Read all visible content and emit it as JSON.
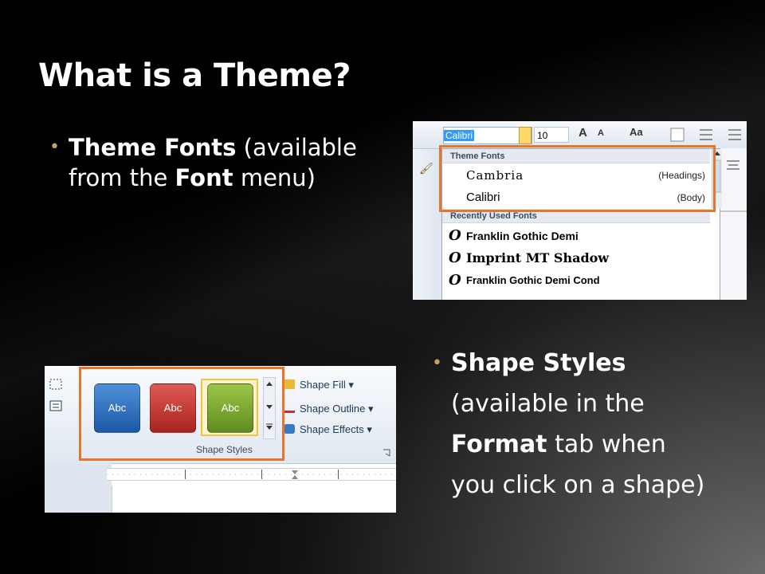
{
  "slide": {
    "title": "What is a Theme?",
    "bullet1": {
      "bold1": "Theme Fonts",
      "text1": " (available from the ",
      "bold2": "Font",
      "text2": " menu)"
    },
    "bullet2": {
      "bold1": "Shape Styles",
      "text1": " (available in the ",
      "bold2": "Format",
      "text2": " tab when you click on a shape)"
    },
    "bullet_color": "#c8a063",
    "highlight_color": "#e8752a"
  },
  "font_menu": {
    "font_name": "Calibri",
    "font_size": "10",
    "grow_label": "A",
    "shrink_label": "A",
    "case_label": "Aa",
    "theme_header": "Theme Fonts",
    "theme_fonts": [
      {
        "name": "Cambria",
        "tag": "(Headings)"
      },
      {
        "name": "Calibri",
        "tag": "(Body)"
      }
    ],
    "recent_header": "Recently Used Fonts",
    "recent_fonts": [
      "Franklin Gothic Demi",
      "Imprint MT Shadow",
      "Franklin Gothic Demi Cond"
    ]
  },
  "shape_styles": {
    "swatches": [
      {
        "label": "Abc",
        "color": "#2e6db6"
      },
      {
        "label": "Abc",
        "color": "#c0312f"
      },
      {
        "label": "Abc",
        "color": "#79a72c"
      }
    ],
    "group_caption": "Shape Styles",
    "commands": [
      "Shape Fill",
      "Shape Outline",
      "Shape Effects"
    ]
  }
}
